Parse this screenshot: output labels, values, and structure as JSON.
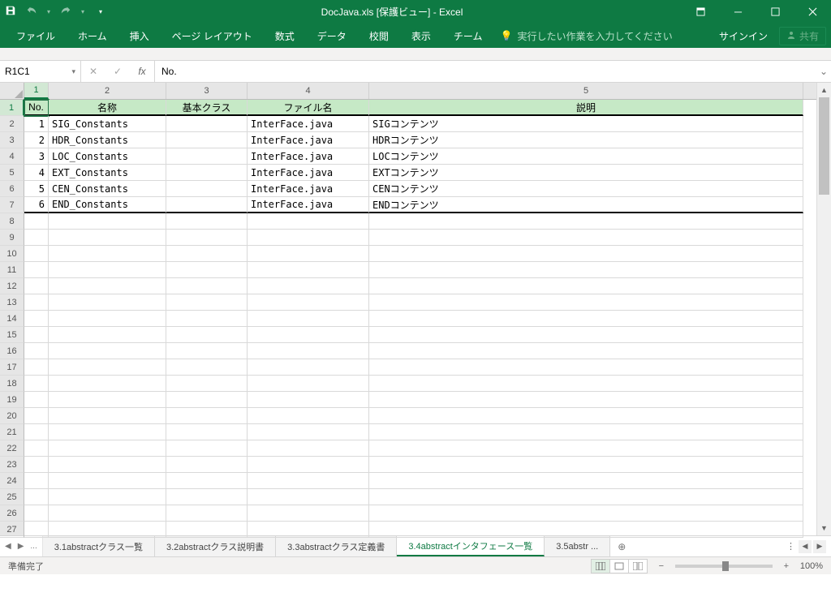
{
  "title": "DocJava.xls  [保護ビュー] - Excel",
  "tabs": {
    "file": "ファイル",
    "home": "ホーム",
    "insert": "挿入",
    "layout": "ページ レイアウト",
    "formulas": "数式",
    "data": "データ",
    "review": "校閲",
    "view": "表示",
    "team": "チーム"
  },
  "tellme": "実行したい作業を入力してください",
  "signin": "サインイン",
  "share": "共有",
  "namebox": "R1C1",
  "formula": "No.",
  "col_headers": [
    "1",
    "2",
    "3",
    "4",
    "5"
  ],
  "row_headers": [
    "1",
    "2",
    "3",
    "4",
    "5",
    "6",
    "7",
    "8",
    "9",
    "10",
    "11",
    "12",
    "13",
    "14",
    "15",
    "16",
    "17",
    "18",
    "19",
    "20",
    "21",
    "22",
    "23",
    "24",
    "25",
    "26",
    "27"
  ],
  "table": {
    "headers": [
      "No.",
      "名称",
      "基本クラス",
      "ファイル名",
      "説明"
    ],
    "rows": [
      {
        "no": "1",
        "name": "SIG_Constants",
        "base": "",
        "file": "InterFace.java",
        "desc": "SIGコンテンツ"
      },
      {
        "no": "2",
        "name": "HDR_Constants",
        "base": "",
        "file": "InterFace.java",
        "desc": "HDRコンテンツ"
      },
      {
        "no": "3",
        "name": "LOC_Constants",
        "base": "",
        "file": "InterFace.java",
        "desc": "LOCコンテンツ"
      },
      {
        "no": "4",
        "name": "EXT_Constants",
        "base": "",
        "file": "InterFace.java",
        "desc": "EXTコンテンツ"
      },
      {
        "no": "5",
        "name": "CEN_Constants",
        "base": "",
        "file": "InterFace.java",
        "desc": "CENコンテンツ"
      },
      {
        "no": "6",
        "name": "END_Constants",
        "base": "",
        "file": "InterFace.java",
        "desc": "ENDコンテンツ"
      }
    ]
  },
  "sheets": {
    "list": [
      "3.1abstractクラス一覧",
      "3.2abstractクラス説明書",
      "3.3abstractクラス定義書",
      "3.4abstractインタフェース一覧",
      "3.5abstr ..."
    ],
    "active": 3,
    "nav_ellipsis": "..."
  },
  "status": "準備完了",
  "zoom": "100%"
}
